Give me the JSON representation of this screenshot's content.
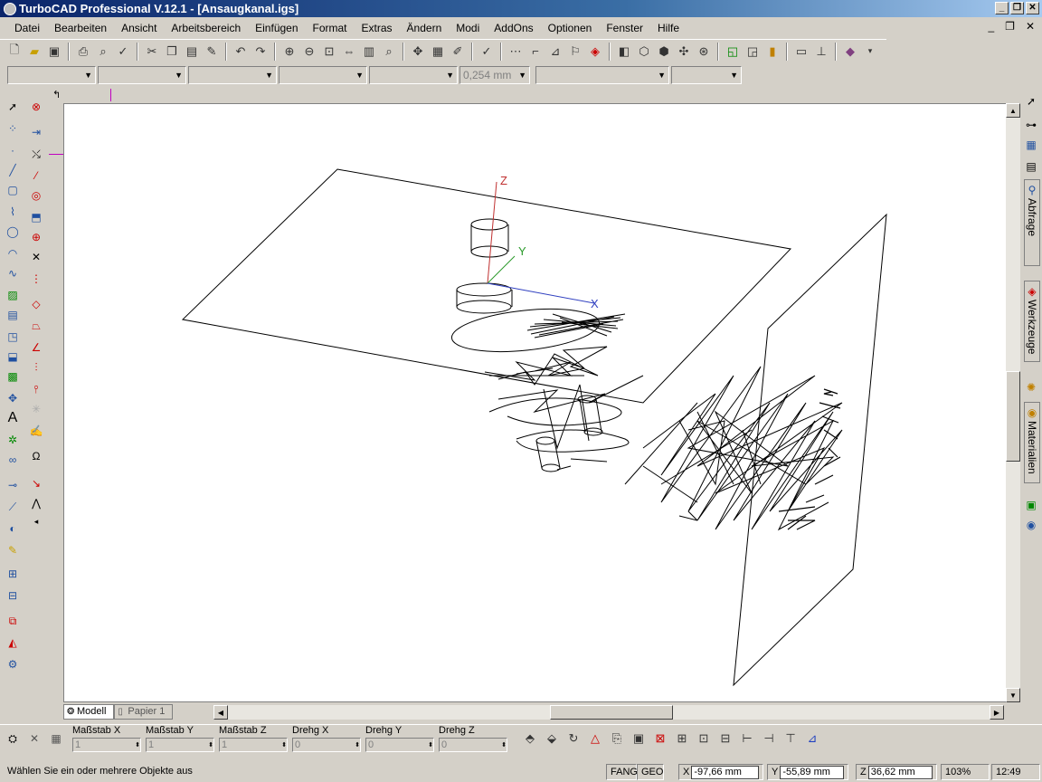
{
  "window": {
    "title": "TurboCAD Professional V.12.1 - [Ansaugkanal.igs]",
    "min": "_",
    "max": "❐",
    "close": "✕"
  },
  "menu": [
    "Datei",
    "Bearbeiten",
    "Ansicht",
    "Arbeitsbereich",
    "Einfügen",
    "Format",
    "Extras",
    "Ändern",
    "Modi",
    "AddOns",
    "Optionen",
    "Fenster",
    "Hilfe"
  ],
  "mdi": {
    "min": "_",
    "restore": "❐",
    "close": "✕"
  },
  "property_toolbar": {
    "combos": [
      "",
      "",
      "",
      "",
      ""
    ],
    "line_width": "0,254 mm",
    "combo2": [
      "",
      ""
    ]
  },
  "canvas": {
    "axis_labels": {
      "z": "Z",
      "y": "Y",
      "x": "X"
    }
  },
  "tabs": [
    {
      "label": "Modell",
      "active": true
    },
    {
      "label": "Papier 1",
      "active": false
    }
  ],
  "right_panel": {
    "tabs": [
      "Abfrage",
      "Werkzeuge",
      "Materialien"
    ]
  },
  "inspector": {
    "fields": [
      {
        "label": "Maßstab X",
        "value": "1"
      },
      {
        "label": "Maßstab Y",
        "value": "1"
      },
      {
        "label": "Maßstab Z",
        "value": "1"
      },
      {
        "label": "Drehg X",
        "value": "0"
      },
      {
        "label": "Drehg Y",
        "value": "0"
      },
      {
        "label": "Drehg Z",
        "value": "0"
      }
    ]
  },
  "status": {
    "message": "Wählen Sie ein oder mehrere Objekte aus",
    "fang": "FANG",
    "geo": "GEO",
    "x_label": "X",
    "x": "-97,66 mm",
    "y_label": "Y",
    "y": "-55,89 mm",
    "z_label": "Z",
    "z": "36,62 mm",
    "zoom": "103%",
    "time": "12:49"
  }
}
